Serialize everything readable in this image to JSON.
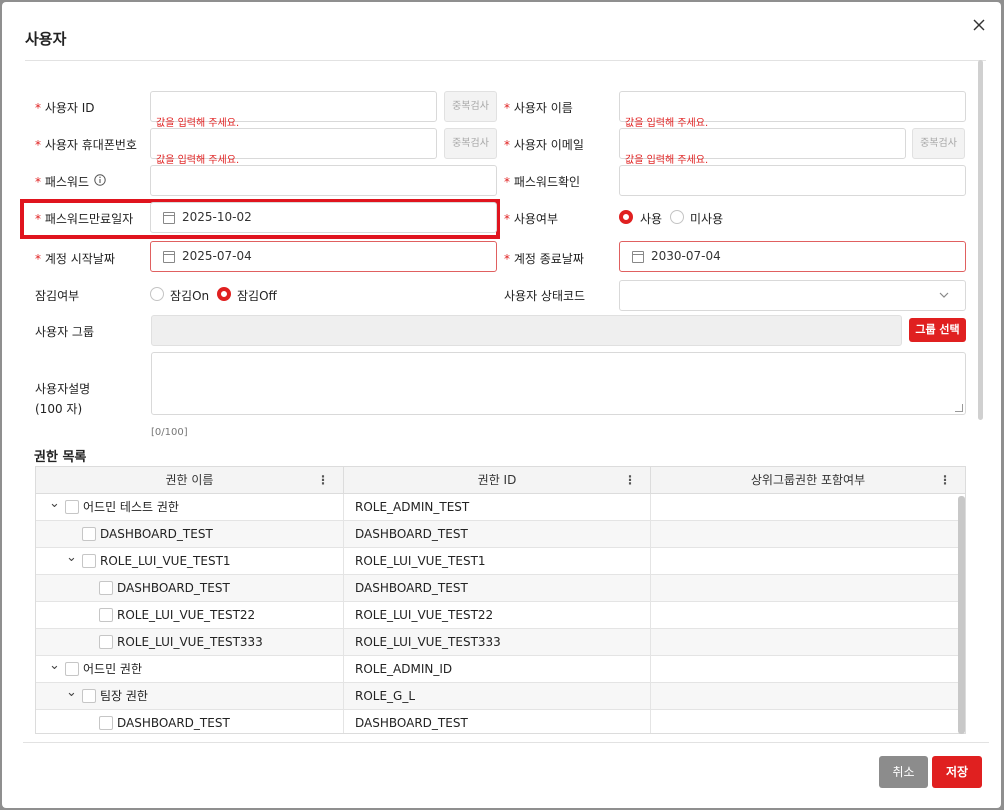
{
  "dialog": {
    "title": "사용자",
    "close_glyph": "✕"
  },
  "form": {
    "user_id_label": "사용자 ID",
    "user_name_label": "사용자 이름",
    "phone_label": "사용자 휴대폰번호",
    "email_label": "사용자 이메일",
    "password_label": "패스워드",
    "password_confirm_label": "패스워드확인",
    "pw_expire_label": "패스워드만료일자",
    "usage_label": "사용여부",
    "acct_start_label": "계정 시작날짜",
    "acct_end_label": "계정 종료날짜",
    "lock_label": "잠김여부",
    "status_code_label": "사용자 상태코드",
    "group_label": "사용자 그룹",
    "desc_label_line1": "사용자설명",
    "desc_label_line2": "(100 자)",
    "error_msg": "값을 입력해 주세요.",
    "dup_check": "중복검사",
    "pw_expire_value": "2025-10-02",
    "acct_start_value": "2025-07-04",
    "acct_end_value": "2030-07-04",
    "usage_on": "사용",
    "usage_off": "미사용",
    "lock_on": "잠김On",
    "lock_off": "잠김Off",
    "group_select_btn": "그룹 선택",
    "desc_counter": "[0/100]"
  },
  "grid": {
    "section_title": "권한 목록",
    "columns": [
      "권한 이름",
      "권한 ID",
      "상위그룹권한 포함여부"
    ],
    "rows": [
      {
        "name": "어드민 테스트 권한",
        "id": "ROLE_ADMIN_TEST",
        "level": 0,
        "expand": true
      },
      {
        "name": "DASHBOARD_TEST",
        "id": "DASHBOARD_TEST",
        "level": 1,
        "expand": false
      },
      {
        "name": "ROLE_LUI_VUE_TEST1",
        "id": "ROLE_LUI_VUE_TEST1",
        "level": 1,
        "expand": true
      },
      {
        "name": "DASHBOARD_TEST",
        "id": "DASHBOARD_TEST",
        "level": 2,
        "expand": false
      },
      {
        "name": "ROLE_LUI_VUE_TEST22",
        "id": "ROLE_LUI_VUE_TEST22",
        "level": 2,
        "expand": false
      },
      {
        "name": "ROLE_LUI_VUE_TEST333",
        "id": "ROLE_LUI_VUE_TEST333",
        "level": 2,
        "expand": false
      },
      {
        "name": "어드민 권한",
        "id": "ROLE_ADMIN_ID",
        "level": 0,
        "expand": true
      },
      {
        "name": "팀장 권한",
        "id": "ROLE_G_L",
        "level": 1,
        "expand": true
      },
      {
        "name": "DASHBOARD_TEST",
        "id": "DASHBOARD_TEST",
        "level": 2,
        "expand": false
      }
    ]
  },
  "footer": {
    "cancel": "취소",
    "save": "저장"
  },
  "colors": {
    "accent": "#e02020",
    "highlight_box": "#e0141e"
  }
}
